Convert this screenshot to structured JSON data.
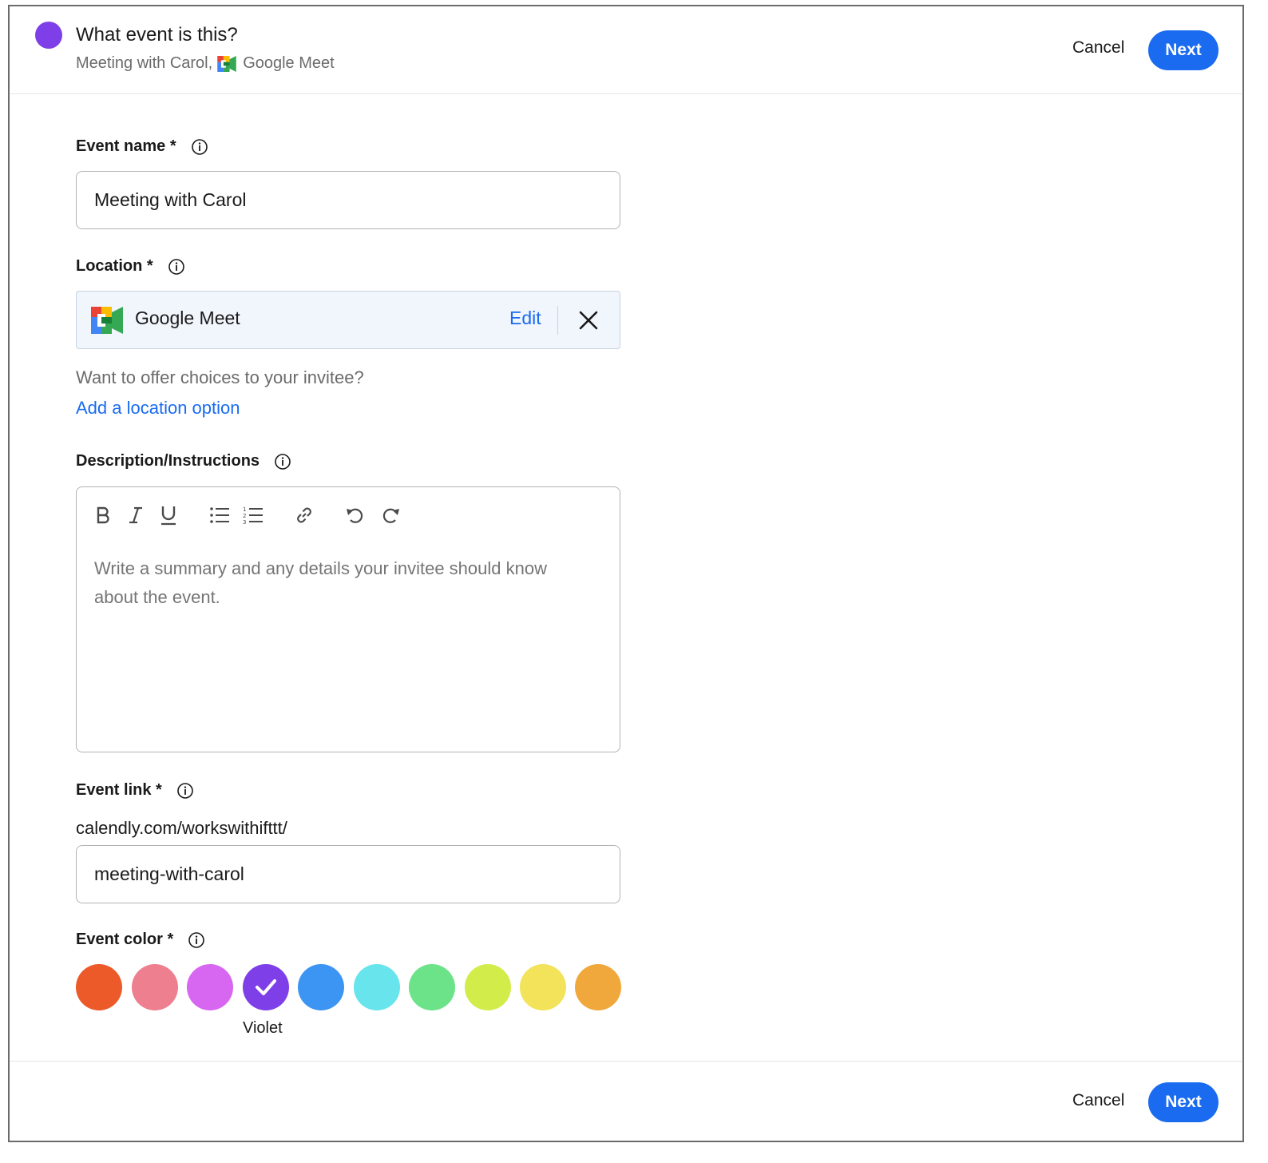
{
  "header": {
    "title": "What event is this?",
    "subtitle_event": "Meeting with Carol,",
    "subtitle_location": "Google Meet",
    "dot_color": "#7f3fe8",
    "cancel_label": "Cancel",
    "next_label": "Next"
  },
  "form": {
    "event_name": {
      "label": "Event name *",
      "value": "Meeting with Carol"
    },
    "location": {
      "label": "Location *",
      "selected": "Google Meet",
      "edit_label": "Edit",
      "helper": "Want to offer choices to your invitee?",
      "add_option": "Add a location option"
    },
    "description": {
      "label": "Description/Instructions",
      "placeholder": "Write a summary and any details your invitee should know about the event.",
      "toolbar": [
        "bold-icon",
        "italic-icon",
        "underline-icon",
        "bullet-list-icon",
        "numbered-list-icon",
        "link-icon",
        "undo-icon",
        "redo-icon"
      ]
    },
    "event_link": {
      "label": "Event link *",
      "prefix": "calendly.com/workswithifttt/",
      "value": "meeting-with-carol"
    },
    "event_color": {
      "label": "Event color *",
      "selected_label": "Violet",
      "colors": [
        "#ec5a2a",
        "#ee7f8e",
        "#d766f0",
        "#7f3fe8",
        "#3d95f3",
        "#68e4ed",
        "#6ce388",
        "#d2ed4a",
        "#f2e35a",
        "#f0a83c"
      ]
    }
  },
  "footer": {
    "cancel_label": "Cancel",
    "next_label": "Next"
  },
  "colors": {
    "primary": "#1a6bf0",
    "text": "#1a1a1a",
    "muted": "#6b6b6b"
  }
}
